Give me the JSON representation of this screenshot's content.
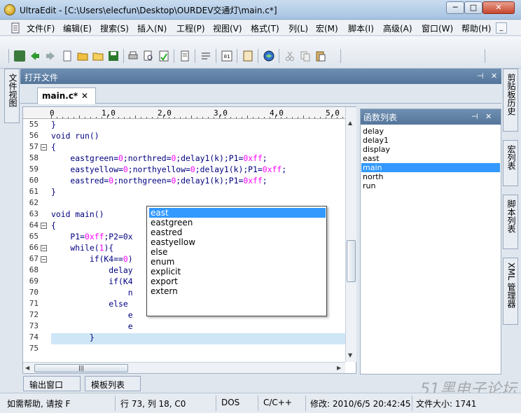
{
  "window": {
    "title": "UltraEdit - [C:\\Users\\elecfun\\Desktop\\OURDEV交通灯\\main.c*]",
    "minimize": "─",
    "maximize": "□",
    "close": "✕"
  },
  "menu": {
    "items": [
      "文件(F)",
      "编辑(E)",
      "搜索(S)",
      "插入(N)",
      "工程(P)",
      "视图(V)",
      "格式(T)",
      "列(L)",
      "宏(M)",
      "脚本(I)",
      "高级(A)",
      "窗口(W)",
      "帮助(H)"
    ],
    "mdi_min": "_",
    "mdi_restore": "❐",
    "mdi_close": "✕"
  },
  "left_panel": {
    "tab": "文件视图"
  },
  "open_files": {
    "title": "打开文件",
    "pin": "⊣",
    "close": "✕"
  },
  "tab": {
    "label": "main.c*",
    "close": "✕"
  },
  "ruler": {
    "labels": [
      "0",
      "1,0",
      "2,0",
      "3,0",
      "4,0",
      "5,0"
    ]
  },
  "editor": {
    "line_numbers": [
      "55",
      "56",
      "57",
      "58",
      "59",
      "60",
      "61",
      "62",
      "63",
      "64",
      "65",
      "66",
      "67",
      "68",
      "69",
      "70",
      "71",
      "72",
      "73",
      "74",
      "75"
    ],
    "lines": [
      "}",
      "void run()",
      "{",
      "    eastgreen=0;northred=0;delay1(k);P1=0xff;",
      "    eastyellow=0;northyellow=0;delay1(k);P1=0xff;",
      "    eastred=0;northgreen=0;delay1(k);P1=0xff;",
      "}",
      "",
      "void main()",
      "{",
      "    P1=0xff;P2=0x",
      "    while(1){",
      "        if(K4==0)",
      "            delay",
      "            if(K4",
      "                n",
      "            else",
      "                e",
      "                e",
      "        }",
      ""
    ]
  },
  "autocomplete": {
    "items": [
      "east",
      "eastgreen",
      "eastred",
      "eastyellow",
      "else",
      "enum",
      "explicit",
      "export",
      "extern"
    ],
    "selected_index": 0
  },
  "function_list": {
    "title": "函数列表",
    "pin": "⊣",
    "close": "✕",
    "items": [
      "delay",
      "delay1",
      "display",
      "east",
      "main",
      "north",
      "run"
    ],
    "selected_index": 4
  },
  "right_tabs": [
    "剪贴板历史",
    "宏列表",
    "脚本列表",
    "XML 管理器"
  ],
  "bottom_tabs": [
    "输出窗口",
    "模板列表"
  ],
  "watermark": "51黑电子论坛",
  "status": {
    "help": "如需帮助, 请按 F",
    "position": "行 73, 列 18, C0",
    "line_ending": "DOS",
    "language": "C/C++",
    "modified": "修改: 2010/6/5 20:42:45",
    "file_size": "文件大小: 1741"
  },
  "colors": {
    "panel_header": "#5f81a7",
    "selection": "#3399ff",
    "current_line": "#cfe6f7",
    "code_text": "#000080",
    "number_literal": "#ff00ff"
  }
}
